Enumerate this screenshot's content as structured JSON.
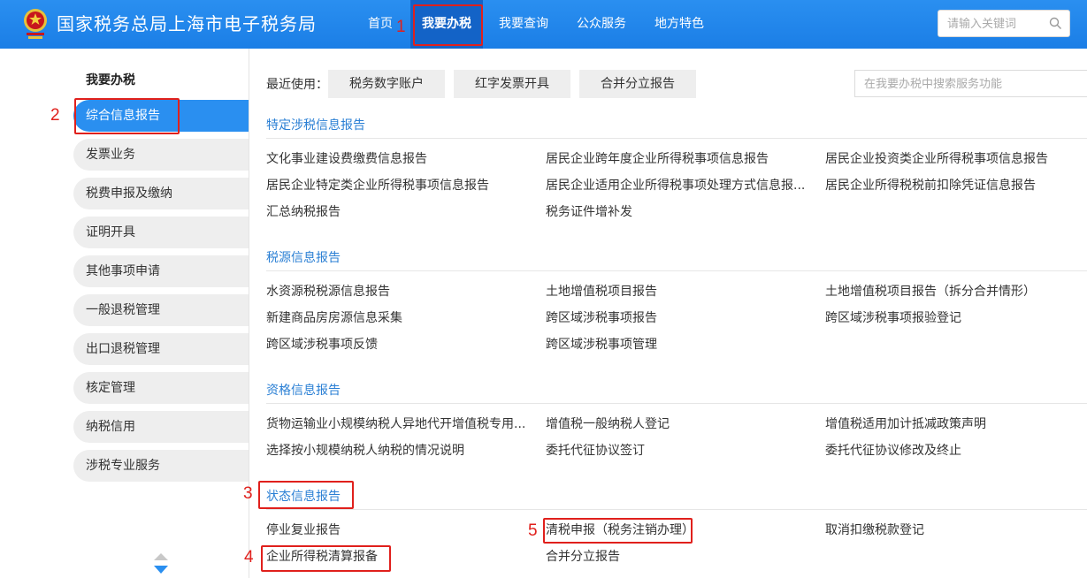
{
  "header": {
    "site_title": "国家税务总局上海市电子税务局",
    "nav": [
      "首页",
      "我要办税",
      "我要查询",
      "公众服务",
      "地方特色"
    ],
    "search_placeholder": "请输入关键词",
    "bg_color": "#1b7ee6"
  },
  "sidebar": {
    "title": "我要办税",
    "items": [
      "综合信息报告",
      "发票业务",
      "税费申报及缴纳",
      "证明开具",
      "其他事项申请",
      "一般退税管理",
      "出口退税管理",
      "核定管理",
      "纳税信用",
      "涉税专业服务"
    ],
    "active_item": "综合信息报告",
    "accent_color": "#2a8ff0"
  },
  "main": {
    "recent_label": "最近使用：",
    "recent": [
      "税务数字账户",
      "红字发票开具",
      "合并分立报告"
    ],
    "search_placeholder": "在我要办税中搜索服务功能",
    "sections": [
      {
        "title": "特定涉税信息报告",
        "links": [
          "文化事业建设费缴费信息报告",
          "居民企业跨年度企业所得税事项信息报告",
          "居民企业投资类企业所得税事项信息报告",
          "居民企业特定类企业所得税事项信息报告",
          "居民企业适用企业所得税事项处理方式信息报...",
          "居民企业所得税税前扣除凭证信息报告",
          "汇总纳税报告",
          "税务证件增补发"
        ]
      },
      {
        "title": "税源信息报告",
        "links": [
          "水资源税税源信息报告",
          "土地增值税项目报告",
          "土地增值税项目报告（拆分合并情形）",
          "新建商品房房源信息采集",
          "跨区域涉税事项报告",
          "跨区域涉税事项报验登记",
          "跨区域涉税事项反馈",
          "跨区域涉税事项管理"
        ]
      },
      {
        "title": "资格信息报告",
        "links": [
          "货物运输业小规模纳税人异地代开增值税专用...",
          "增值税一般纳税人登记",
          "增值税适用加计抵减政策声明",
          "选择按小规模纳税人纳税的情况说明",
          "委托代征协议签订",
          "委托代征协议修改及终止"
        ]
      },
      {
        "title": "状态信息报告",
        "links": [
          "停业复业报告",
          "清税申报（税务注销办理）",
          "取消扣缴税款登记",
          "企业所得税清算报备",
          "合并分立报告"
        ]
      }
    ],
    "link_color": "#2a7fd4"
  },
  "annotations": [
    "1",
    "2",
    "3",
    "4",
    "5"
  ],
  "annotation_color": "#e0201c"
}
